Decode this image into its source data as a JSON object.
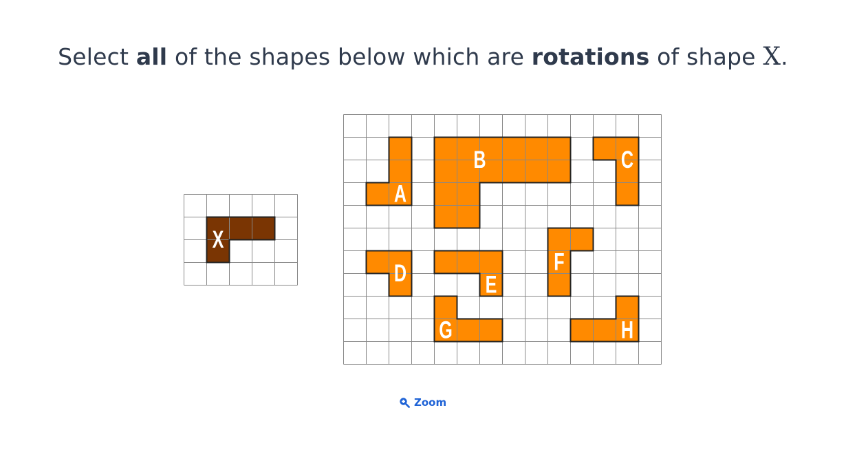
{
  "question": {
    "prefix": "Select ",
    "bold1": "all",
    "middle": " of the shapes below which are ",
    "bold2": "rotations",
    "suffix": " of shape ",
    "variable": "X",
    "end": "."
  },
  "zoom": {
    "label": "Zoom",
    "icon": "zoom-in-icon"
  },
  "colors": {
    "target_fill": "#7a3503",
    "option_fill": "#ff8a00",
    "outline": "#222222",
    "grid_line": "#888888",
    "label": "#ffffff",
    "zoom": "#1f63d6"
  },
  "reference_grid": {
    "cols": 5,
    "rows": 4,
    "shape": {
      "label": "X",
      "cells": [
        [
          1,
          1
        ],
        [
          2,
          1
        ],
        [
          3,
          1
        ],
        [
          1,
          2
        ]
      ],
      "label_cell": [
        1,
        1.5
      ]
    }
  },
  "options_grid": {
    "cols": 14,
    "rows": 11,
    "shapes": [
      {
        "label": "A",
        "cells": [
          [
            2,
            1
          ],
          [
            2,
            2
          ],
          [
            2,
            3
          ],
          [
            1,
            3
          ]
        ],
        "label_cell": [
          2,
          3
        ]
      },
      {
        "label": "B",
        "cells": [
          [
            4,
            1
          ],
          [
            5,
            1
          ],
          [
            6,
            1
          ],
          [
            7,
            1
          ],
          [
            8,
            1
          ],
          [
            9,
            1
          ],
          [
            4,
            2
          ],
          [
            5,
            2
          ],
          [
            6,
            2
          ],
          [
            7,
            2
          ],
          [
            8,
            2
          ],
          [
            9,
            2
          ],
          [
            4,
            3
          ],
          [
            5,
            3
          ],
          [
            4,
            4
          ],
          [
            5,
            4
          ]
        ],
        "label_cell": [
          5.5,
          1.5
        ]
      },
      {
        "label": "C",
        "cells": [
          [
            11,
            1
          ],
          [
            12,
            1
          ],
          [
            12,
            2
          ],
          [
            12,
            3
          ]
        ],
        "label_cell": [
          12,
          1.5
        ]
      },
      {
        "label": "D",
        "cells": [
          [
            1,
            6
          ],
          [
            2,
            6
          ],
          [
            2,
            7
          ]
        ],
        "label_cell": [
          2,
          6.5
        ]
      },
      {
        "label": "E",
        "cells": [
          [
            4,
            6
          ],
          [
            5,
            6
          ],
          [
            6,
            6
          ],
          [
            6,
            7
          ]
        ],
        "label_cell": [
          6,
          7
        ]
      },
      {
        "label": "F",
        "cells": [
          [
            9,
            5
          ],
          [
            10,
            5
          ],
          [
            9,
            6
          ],
          [
            9,
            7
          ]
        ],
        "label_cell": [
          9,
          6
        ]
      },
      {
        "label": "G",
        "cells": [
          [
            4,
            8
          ],
          [
            4,
            9
          ],
          [
            5,
            9
          ],
          [
            6,
            9
          ]
        ],
        "label_cell": [
          4,
          9
        ]
      },
      {
        "label": "H",
        "cells": [
          [
            12,
            8
          ],
          [
            12,
            9
          ],
          [
            11,
            9
          ],
          [
            10,
            9
          ]
        ],
        "label_cell": [
          12,
          9
        ]
      }
    ]
  }
}
